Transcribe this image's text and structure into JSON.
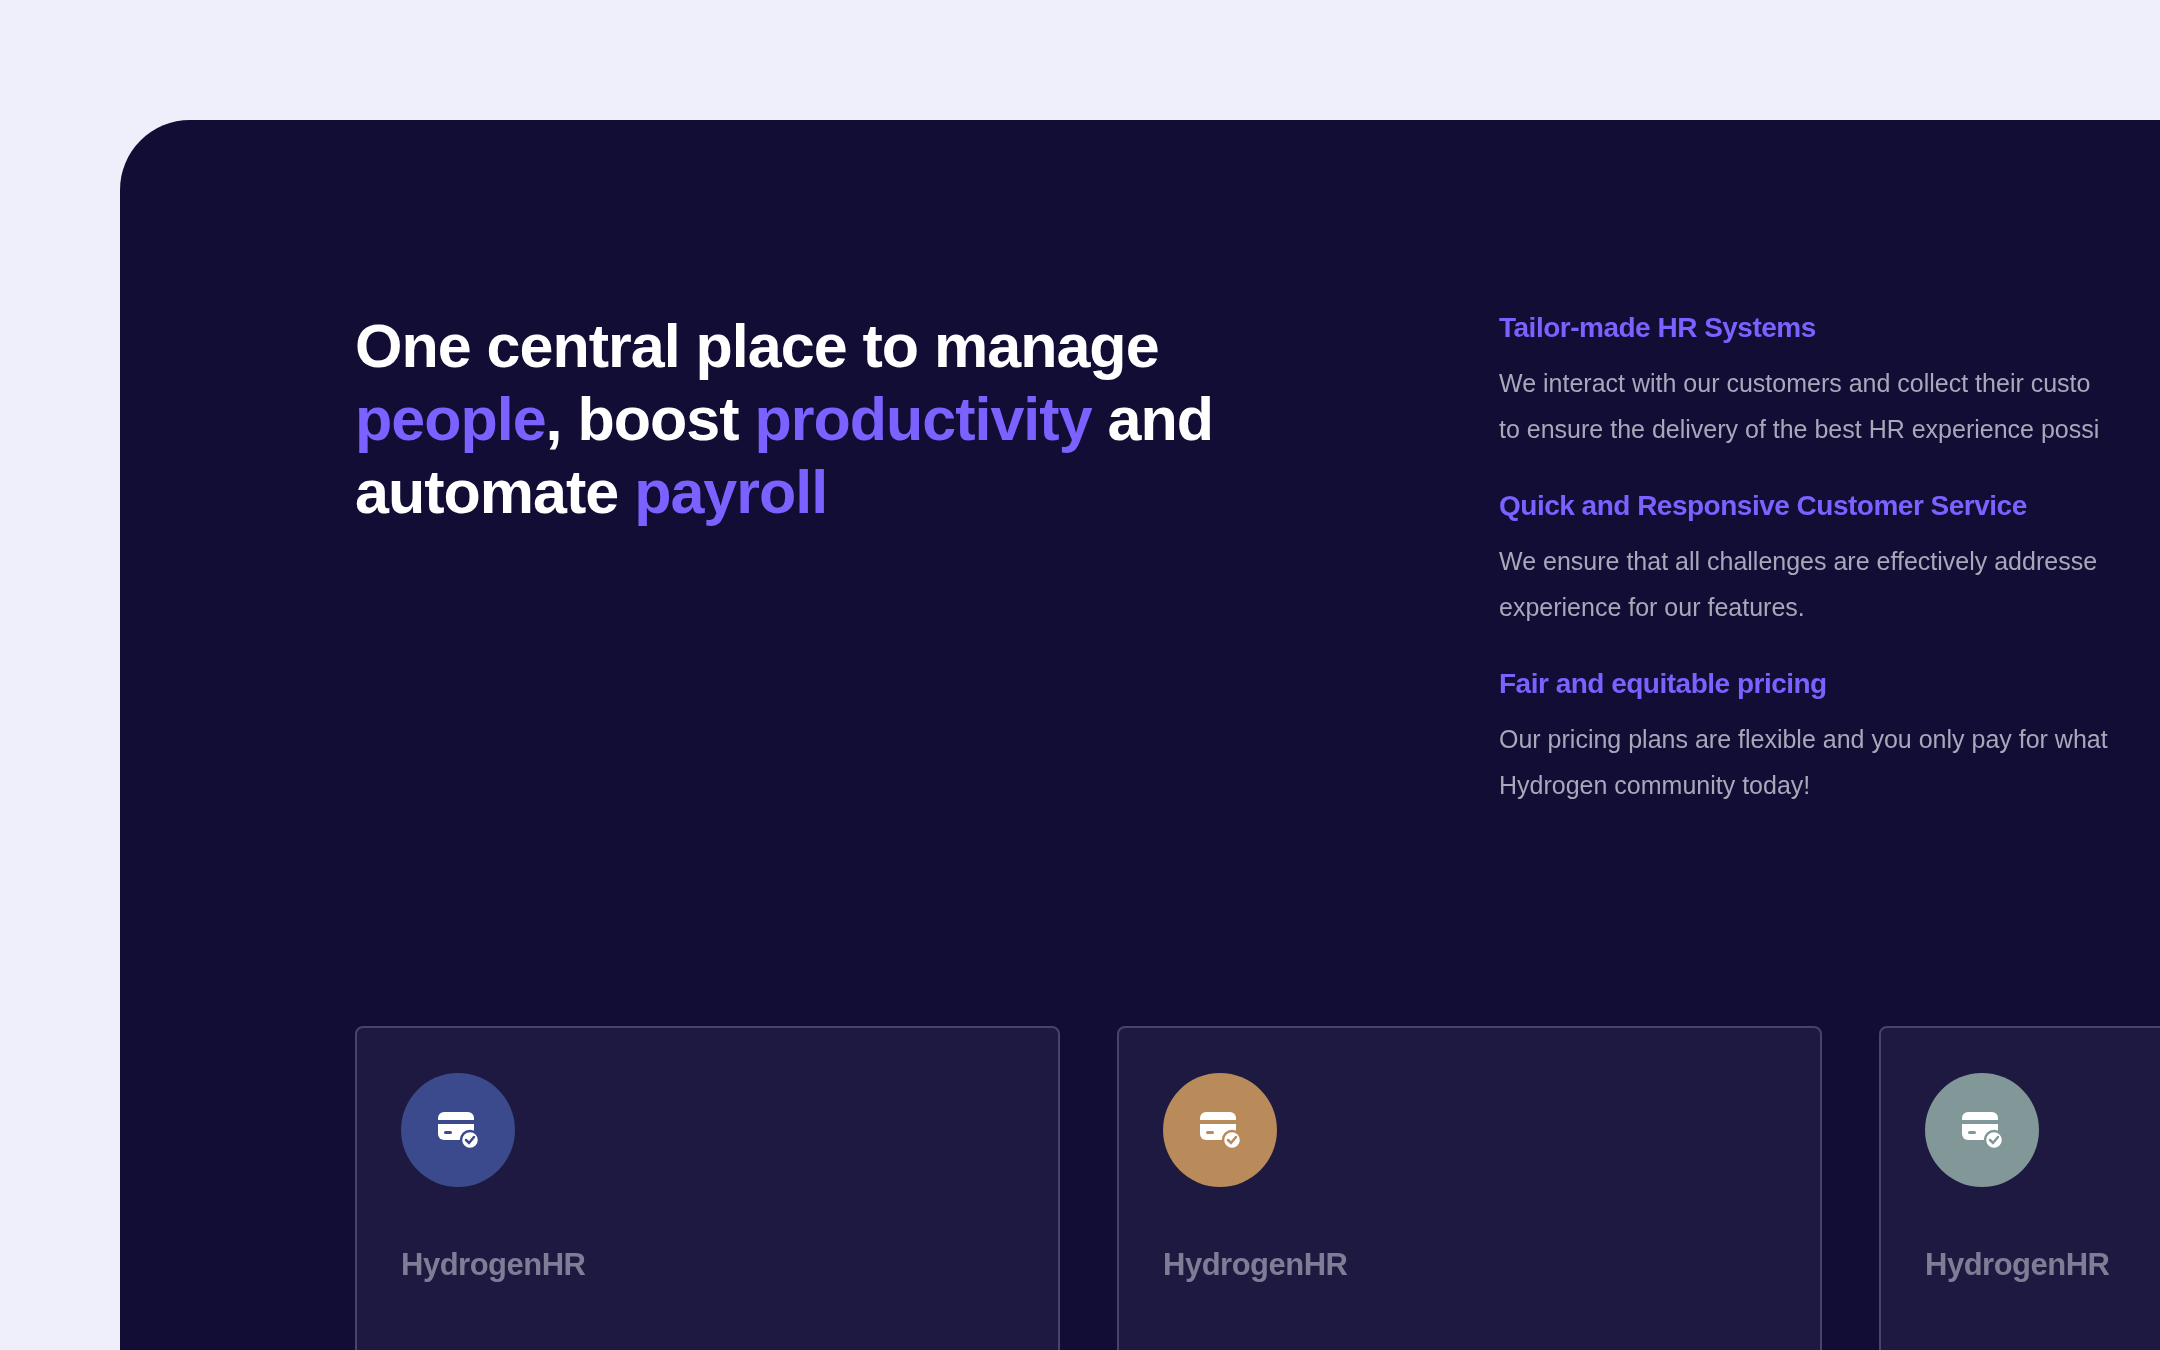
{
  "headline": {
    "lines": [
      [
        {
          "text": "One central place to manage",
          "accent": false
        }
      ],
      [
        {
          "text": "people",
          "accent": true
        },
        {
          "text": ", boost ",
          "accent": false
        },
        {
          "text": "productivity",
          "accent": true
        },
        {
          "text": " and",
          "accent": false
        }
      ],
      [
        {
          "text": "automate ",
          "accent": false
        },
        {
          "text": "payroll",
          "accent": true
        }
      ]
    ]
  },
  "features": [
    {
      "title": "Tailor-made HR Systems",
      "lines": [
        "We interact with our customers and collect their custo",
        "to ensure the delivery of the best HR experience possi"
      ]
    },
    {
      "title": "Quick and Responsive Customer Service",
      "lines": [
        "We ensure that all challenges are effectively addresse",
        "experience for our features."
      ]
    },
    {
      "title": "Fair and equitable pricing",
      "lines": [
        "Our pricing plans are flexible and you only pay for what",
        "Hydrogen community today!"
      ]
    }
  ],
  "cards": [
    {
      "color": "#3b4a8c",
      "brand": "HydrogenHR"
    },
    {
      "color": "#b98a5a",
      "brand": "HydrogenHR"
    },
    {
      "color": "#829898",
      "brand": "HydrogenHR"
    }
  ]
}
